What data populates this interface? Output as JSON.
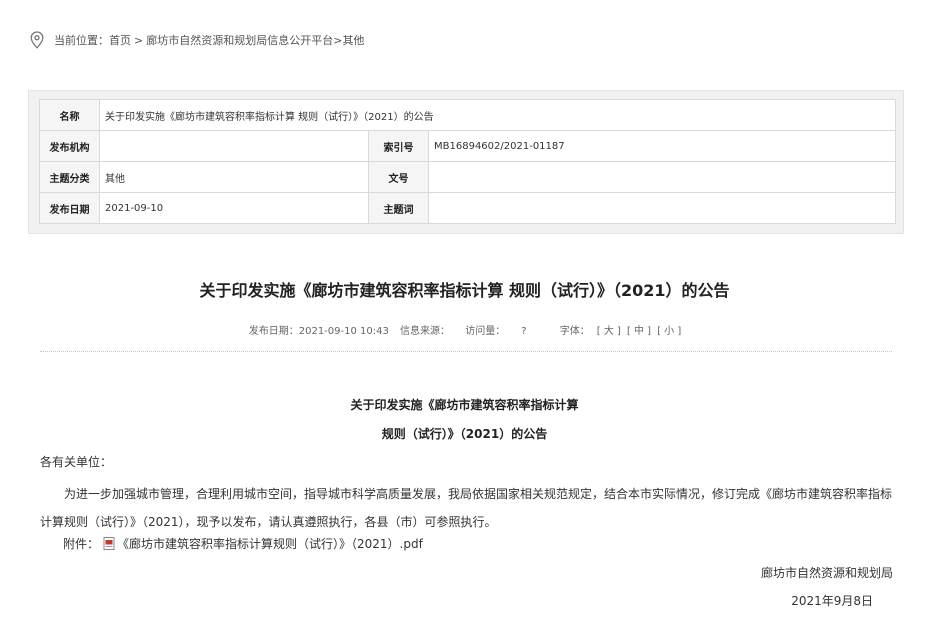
{
  "breadcrumb": {
    "prefix": "当前位置：",
    "home": "首页",
    "sep": ">",
    "platform": "廊坊市自然资源和规划局信息公开平台",
    "sep2": ">",
    "category": "其他"
  },
  "meta_table": {
    "name_label": "名称",
    "name_value": "关于印发实施《廊坊市建筑容积率指标计算 规则（试行）》（2021）的公告",
    "publisher_label": "发布机构",
    "publisher_value": "",
    "index_label": "索引号",
    "index_value": "MB16894602/2021-01187",
    "topic_label": "主题分类",
    "topic_value": "其他",
    "docno_label": "文号",
    "docno_value": "",
    "date_label": "发布日期",
    "date_value": "2021-09-10",
    "keywords_label": "主题词",
    "keywords_value": ""
  },
  "article": {
    "title": "关于印发实施《廊坊市建筑容积率指标计算 规则（试行）》（2021）的公告",
    "publish_time": "发布日期：2021-09-10 10:43",
    "source": "信息来源：",
    "views": "访问量：",
    "views_value": "?",
    "font_size_label": "字体：",
    "size_large": "[ 大 ]",
    "size_medium": "[ 中 ]",
    "size_small": "[ 小 ]",
    "subtitle_line1": "关于印发实施《廊坊市建筑容积率指标计算",
    "subtitle_line2": "规则（试行）》（2021）的公告",
    "greeting": "各有关单位：",
    "paragraph": "为进一步加强城市管理，合理利用城市空间，指导城市科学高质量发展，我局依据国家相关规范规定，结合本市实际情况，修订完成《廊坊市建筑容积率指标计算规则（试行）》（2021），现予以发布，请认真遵照执行，各县（市）可参照执行。",
    "attachment_label": "附件：",
    "attachment_file": "《廊坊市建筑容积率指标计算规则（试行）》（2021）.pdf",
    "signature": "廊坊市自然资源和规划局",
    "sign_date": "2021年9月8日"
  },
  "colors": {
    "accent_pdf": "#c0392b",
    "label_bg": "#f5f5f5",
    "panel_bg": "#f1f1f1"
  },
  "icons": [
    "location-pin-icon",
    "pdf-file-icon"
  ]
}
